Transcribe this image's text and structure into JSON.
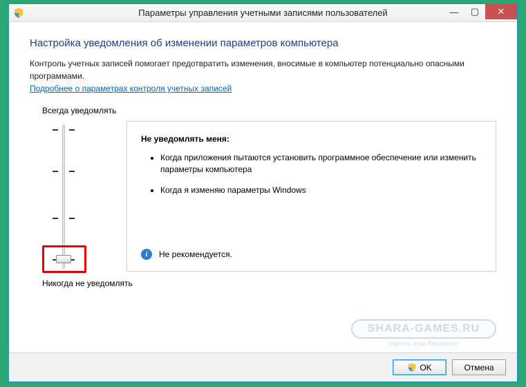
{
  "window": {
    "title": "Параметры управления учетными записями пользователей"
  },
  "controls": {
    "minimize": "—",
    "maximize": "▢",
    "close": "✕"
  },
  "content": {
    "heading": "Настройка уведомления об изменении параметров компьютера",
    "intro": "Контроль учетных записей помогает предотвратить изменения, вносимые в компьютер потенциально опасными программами.",
    "link": "Подробнее о параметрах контроля учетных записей",
    "slider_top_label": "Всегда уведомлять",
    "slider_bottom_label": "Никогда не уведомлять",
    "slider_level": 0,
    "desc_title": "Не уведомлять меня:",
    "bullets": [
      "Когда приложения пытаются установить программное обеспечение или изменить параметры компьютера",
      "Когда я изменяю параметры Windows"
    ],
    "recommendation": "Не рекомендуется."
  },
  "buttons": {
    "ok": "OK",
    "cancel": "Отмена"
  },
  "watermark": {
    "main": "SHARA-GAMES.RU",
    "sub": "скачать игры бесплатно"
  }
}
